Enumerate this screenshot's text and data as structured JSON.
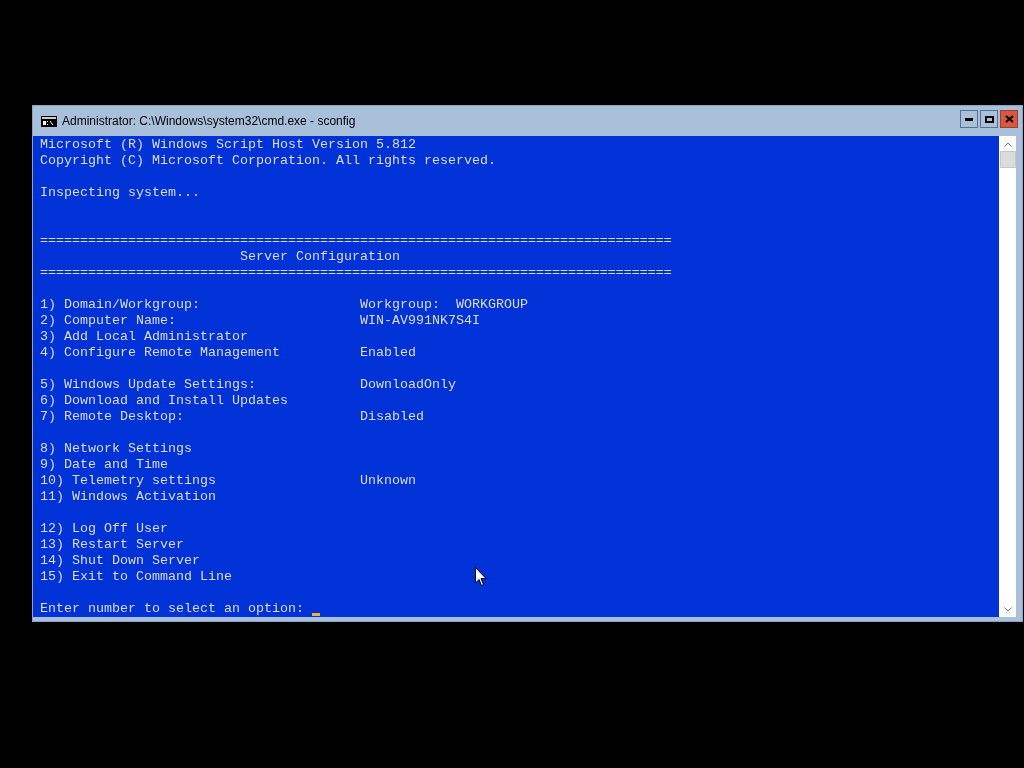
{
  "window": {
    "title": "Administrator: C:\\Windows\\system32\\cmd.exe - sconfig"
  },
  "console": {
    "lines": [
      {
        "kind": "text",
        "text": "Microsoft (R) Windows Script Host Version 5.812"
      },
      {
        "kind": "text",
        "text": "Copyright (C) Microsoft Corporation. All rights reserved."
      },
      {
        "kind": "blank"
      },
      {
        "kind": "text",
        "text": "Inspecting system..."
      },
      {
        "kind": "blank"
      },
      {
        "kind": "blank"
      },
      {
        "kind": "rule",
        "text": "==============================================================================="
      },
      {
        "kind": "heading",
        "text": "Server Configuration"
      },
      {
        "kind": "rule",
        "text": "==============================================================================="
      },
      {
        "kind": "blank"
      },
      {
        "kind": "item",
        "text": "1) Domain/Workgroup:",
        "value": "Workgroup:  WORKGROUP"
      },
      {
        "kind": "item",
        "text": "2) Computer Name:",
        "value": "WIN-AV991NK7S4I"
      },
      {
        "kind": "item",
        "text": "3) Add Local Administrator"
      },
      {
        "kind": "item",
        "text": "4) Configure Remote Management",
        "value": "Enabled"
      },
      {
        "kind": "blank"
      },
      {
        "kind": "item",
        "text": "5) Windows Update Settings:",
        "value": "DownloadOnly"
      },
      {
        "kind": "item",
        "text": "6) Download and Install Updates"
      },
      {
        "kind": "item",
        "text": "7) Remote Desktop:",
        "value": "Disabled"
      },
      {
        "kind": "blank"
      },
      {
        "kind": "item",
        "text": "8) Network Settings"
      },
      {
        "kind": "item",
        "text": "9) Date and Time"
      },
      {
        "kind": "item",
        "text": "10) Telemetry settings",
        "value": "Unknown"
      },
      {
        "kind": "item",
        "text": "11) Windows Activation"
      },
      {
        "kind": "blank"
      },
      {
        "kind": "item",
        "text": "12) Log Off User"
      },
      {
        "kind": "item",
        "text": "13) Restart Server"
      },
      {
        "kind": "item",
        "text": "14) Shut Down Server"
      },
      {
        "kind": "item",
        "text": "15) Exit to Command Line"
      },
      {
        "kind": "blank"
      },
      {
        "kind": "prompt",
        "text": "Enter number to select an option:"
      }
    ]
  }
}
